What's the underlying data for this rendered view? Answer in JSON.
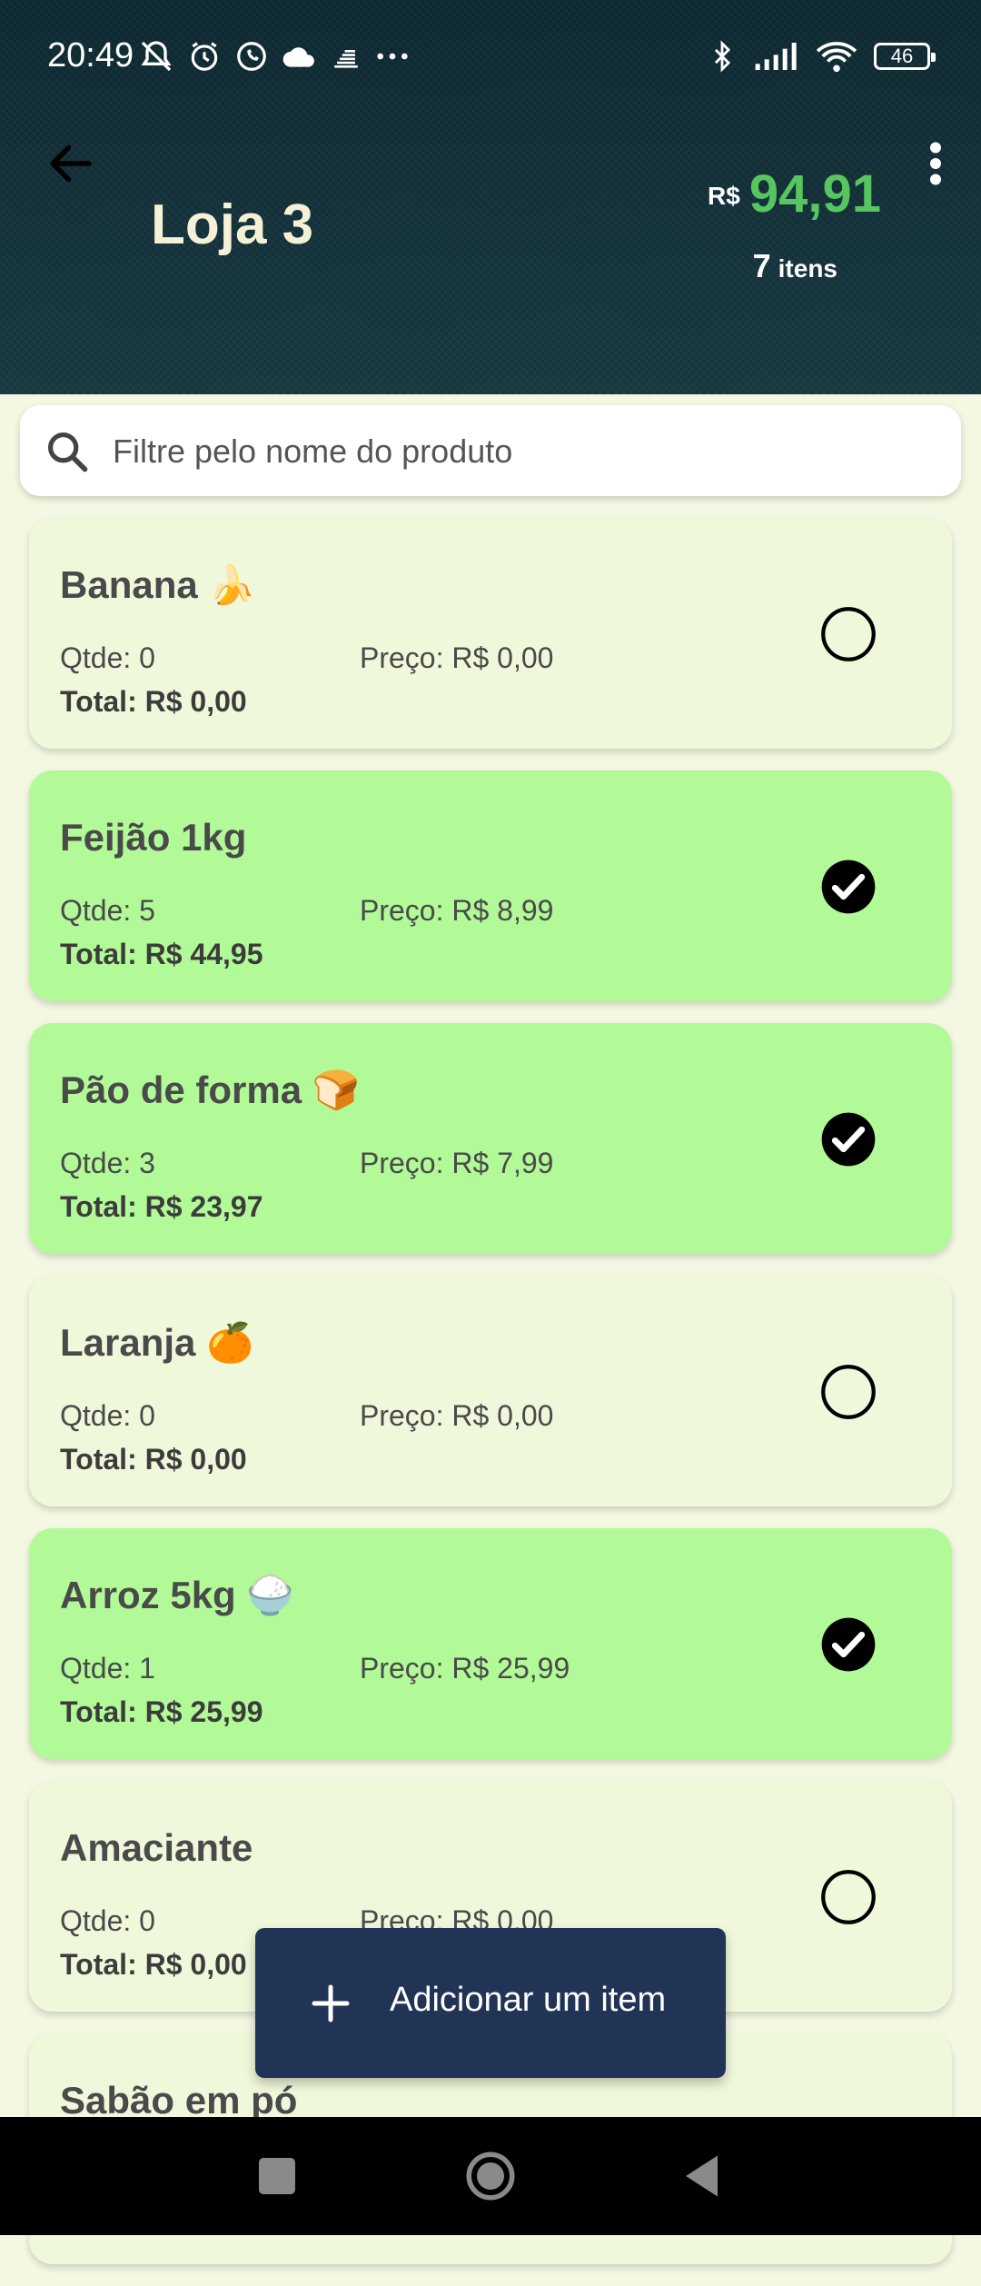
{
  "status_bar": {
    "time": "20:49",
    "battery": "46",
    "left_icons": [
      "mute-icon",
      "alarm-icon",
      "whatsapp-icon",
      "cloud-icon",
      "signal-alt-icon",
      "more-dots-icon"
    ],
    "right_icons": [
      "bluetooth-icon",
      "cell-signal-icon",
      "wifi-icon",
      "battery-icon"
    ]
  },
  "header": {
    "title": "Loja 3",
    "currency": "R$",
    "total": "94,91",
    "items_count": "7",
    "items_label": "itens",
    "bg_color": "#14303a",
    "total_color": "#57c560"
  },
  "search": {
    "placeholder": "Filtre pelo nome do produto"
  },
  "items": [
    {
      "name": "Banana 🍌",
      "qty": "Qtde: 0",
      "price": "Preço: R$ 0,00",
      "total": "Total: R$ 0,00",
      "checked": false
    },
    {
      "name": "Feijão 1kg",
      "qty": "Qtde: 5",
      "price": "Preço: R$ 8,99",
      "total": "Total: R$ 44,95",
      "checked": true
    },
    {
      "name": "Pão de forma 🍞",
      "qty": "Qtde: 3",
      "price": "Preço: R$ 7,99",
      "total": "Total: R$ 23,97",
      "checked": true
    },
    {
      "name": "Laranja 🍊",
      "qty": "Qtde: 0",
      "price": "Preço: R$ 0,00",
      "total": "Total: R$ 0,00",
      "checked": false
    },
    {
      "name": "Arroz 5kg 🍚",
      "qty": "Qtde: 1",
      "price": "Preço: R$ 25,99",
      "total": "Total: R$ 25,99",
      "checked": true
    },
    {
      "name": "Amaciante",
      "qty": "Qtde: 0",
      "price": "Preço: R$ 0,00",
      "total": "Total: R$ 0,00",
      "checked": false
    },
    {
      "name": "Sabão em pó",
      "qty": "",
      "price": "",
      "total": "",
      "checked": false
    }
  ],
  "fab": {
    "label": "Adicionar um item",
    "bg_color": "#223456"
  },
  "colors": {
    "checked_card": "#b2fa98",
    "unchecked_card": "#f0f8db",
    "page_bg": "#f4f8e2"
  }
}
